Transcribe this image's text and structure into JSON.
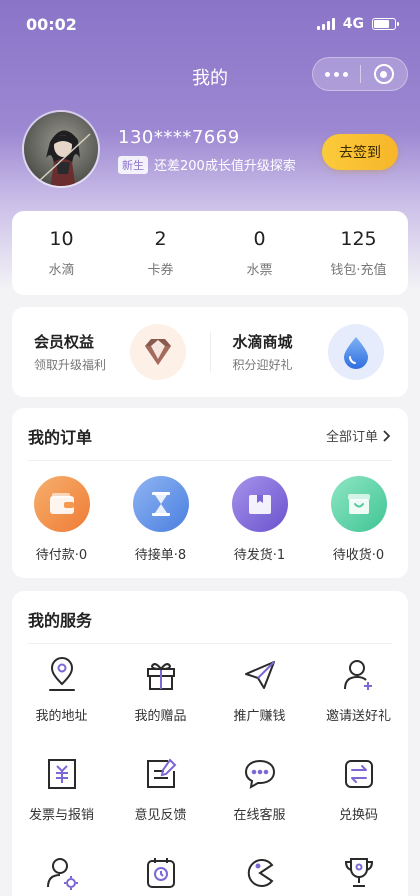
{
  "status_bar": {
    "time": "00:02",
    "network": "4G",
    "battery_level": 0.75
  },
  "nav": {
    "title": "我的"
  },
  "profile": {
    "phone": "130****7669",
    "level_badge": "新生",
    "level_text": "还差200成长值升级探索",
    "signin_label": "去签到"
  },
  "stats": [
    {
      "value": "10",
      "label": "水滴"
    },
    {
      "value": "2",
      "label": "卡券"
    },
    {
      "value": "0",
      "label": "水票"
    },
    {
      "value": "125",
      "label": "钱包·充值"
    }
  ],
  "promos": [
    {
      "title": "会员权益",
      "subtitle": "领取升级福利",
      "icon": "diamond-icon"
    },
    {
      "title": "水滴商城",
      "subtitle": "积分迎好礼",
      "icon": "water-drop-icon"
    }
  ],
  "orders": {
    "title": "我的订单",
    "all_label": "全部订单",
    "items": [
      {
        "label": "待付款·0",
        "icon": "wallet-icon",
        "color": "#f0893b"
      },
      {
        "label": "待接单·8",
        "icon": "hourglass-icon",
        "color": "#5d8ee6"
      },
      {
        "label": "待发货·1",
        "icon": "box-icon",
        "color": "#7d67d6"
      },
      {
        "label": "待收货·0",
        "icon": "shopping-bag-icon",
        "color": "#54cfa0"
      }
    ]
  },
  "services": {
    "title": "我的服务",
    "items": [
      {
        "label": "我的地址",
        "icon": "location-pin-icon"
      },
      {
        "label": "我的赠品",
        "icon": "gift-icon"
      },
      {
        "label": "推广赚钱",
        "icon": "paper-plane-icon"
      },
      {
        "label": "邀请送好礼",
        "icon": "add-user-icon"
      },
      {
        "label": "发票与报销",
        "icon": "invoice-icon"
      },
      {
        "label": "意见反馈",
        "icon": "feedback-icon"
      },
      {
        "label": "在线客服",
        "icon": "chat-icon"
      },
      {
        "label": "兑换码",
        "icon": "exchange-icon"
      },
      {
        "label": "",
        "icon": "user-settings-icon"
      },
      {
        "label": "",
        "icon": "timer-icon"
      },
      {
        "label": "",
        "icon": "pacman-icon"
      },
      {
        "label": "",
        "icon": "trophy-icon"
      }
    ]
  }
}
